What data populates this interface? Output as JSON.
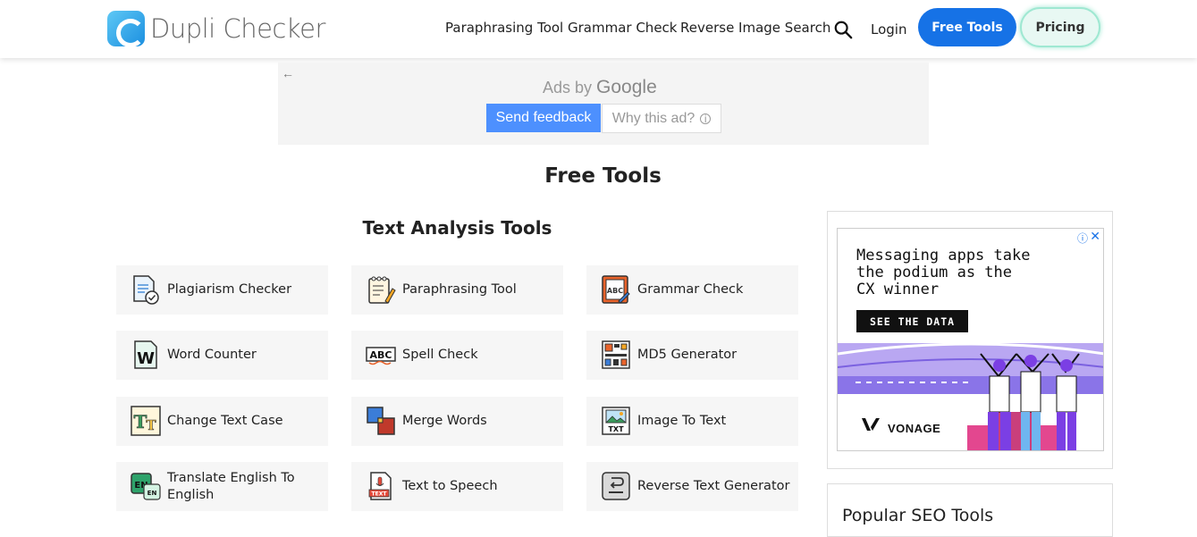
{
  "header": {
    "logo_text": "Dupli Checker",
    "nav": [
      "Paraphrasing Tool",
      "Grammar Check",
      "Reverse Image Search"
    ],
    "login": "Login",
    "free_tools": "Free Tools",
    "pricing": "Pricing"
  },
  "ad_strip": {
    "ads_by": "Ads by",
    "google": "Google",
    "send_feedback": "Send feedback",
    "why_this_ad": "Why this ad?"
  },
  "page": {
    "title": "Free Tools",
    "subtitle": "Text Analysis Tools"
  },
  "tools": [
    {
      "label": "Plagiarism Checker",
      "icon": "plagiarism-icon"
    },
    {
      "label": "Paraphrasing Tool",
      "icon": "paraphrasing-icon"
    },
    {
      "label": "Grammar Check",
      "icon": "grammar-icon"
    },
    {
      "label": "Word Counter",
      "icon": "word-counter-icon"
    },
    {
      "label": "Spell Check",
      "icon": "spell-check-icon"
    },
    {
      "label": "MD5 Generator",
      "icon": "md5-icon"
    },
    {
      "label": "Change Text Case",
      "icon": "text-case-icon"
    },
    {
      "label": "Merge Words",
      "icon": "merge-words-icon"
    },
    {
      "label": "Image To Text",
      "icon": "image-to-text-icon"
    },
    {
      "label": "Translate English To English",
      "icon": "translate-icon"
    },
    {
      "label": "Text to Speech",
      "icon": "text-to-speech-icon"
    },
    {
      "label": "Reverse Text Generator",
      "icon": "reverse-text-icon"
    }
  ],
  "side_ad": {
    "headline": "Messaging apps take\nthe podium as the\nCX winner",
    "cta": "SEE THE DATA",
    "brand": "VONAGE"
  },
  "seo": {
    "title": "Popular SEO Tools"
  }
}
